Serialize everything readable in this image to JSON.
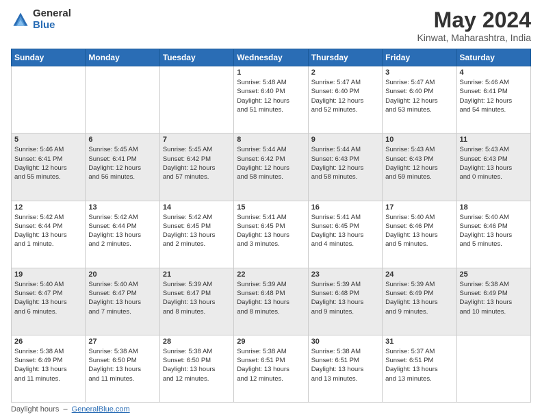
{
  "header": {
    "logo_general": "General",
    "logo_blue": "Blue",
    "month_title": "May 2024",
    "location": "Kinwat, Maharashtra, India"
  },
  "calendar": {
    "days_of_week": [
      "Sunday",
      "Monday",
      "Tuesday",
      "Wednesday",
      "Thursday",
      "Friday",
      "Saturday"
    ],
    "weeks": [
      {
        "id": 1,
        "cells": [
          {
            "day": "",
            "info": ""
          },
          {
            "day": "",
            "info": ""
          },
          {
            "day": "",
            "info": ""
          },
          {
            "day": "1",
            "info": "Sunrise: 5:48 AM\nSunset: 6:40 PM\nDaylight: 12 hours\nand 51 minutes."
          },
          {
            "day": "2",
            "info": "Sunrise: 5:47 AM\nSunset: 6:40 PM\nDaylight: 12 hours\nand 52 minutes."
          },
          {
            "day": "3",
            "info": "Sunrise: 5:47 AM\nSunset: 6:40 PM\nDaylight: 12 hours\nand 53 minutes."
          },
          {
            "day": "4",
            "info": "Sunrise: 5:46 AM\nSunset: 6:41 PM\nDaylight: 12 hours\nand 54 minutes."
          }
        ]
      },
      {
        "id": 2,
        "cells": [
          {
            "day": "5",
            "info": "Sunrise: 5:46 AM\nSunset: 6:41 PM\nDaylight: 12 hours\nand 55 minutes."
          },
          {
            "day": "6",
            "info": "Sunrise: 5:45 AM\nSunset: 6:41 PM\nDaylight: 12 hours\nand 56 minutes."
          },
          {
            "day": "7",
            "info": "Sunrise: 5:45 AM\nSunset: 6:42 PM\nDaylight: 12 hours\nand 57 minutes."
          },
          {
            "day": "8",
            "info": "Sunrise: 5:44 AM\nSunset: 6:42 PM\nDaylight: 12 hours\nand 58 minutes."
          },
          {
            "day": "9",
            "info": "Sunrise: 5:44 AM\nSunset: 6:43 PM\nDaylight: 12 hours\nand 58 minutes."
          },
          {
            "day": "10",
            "info": "Sunrise: 5:43 AM\nSunset: 6:43 PM\nDaylight: 12 hours\nand 59 minutes."
          },
          {
            "day": "11",
            "info": "Sunrise: 5:43 AM\nSunset: 6:43 PM\nDaylight: 13 hours\nand 0 minutes."
          }
        ]
      },
      {
        "id": 3,
        "cells": [
          {
            "day": "12",
            "info": "Sunrise: 5:42 AM\nSunset: 6:44 PM\nDaylight: 13 hours\nand 1 minute."
          },
          {
            "day": "13",
            "info": "Sunrise: 5:42 AM\nSunset: 6:44 PM\nDaylight: 13 hours\nand 2 minutes."
          },
          {
            "day": "14",
            "info": "Sunrise: 5:42 AM\nSunset: 6:45 PM\nDaylight: 13 hours\nand 2 minutes."
          },
          {
            "day": "15",
            "info": "Sunrise: 5:41 AM\nSunset: 6:45 PM\nDaylight: 13 hours\nand 3 minutes."
          },
          {
            "day": "16",
            "info": "Sunrise: 5:41 AM\nSunset: 6:45 PM\nDaylight: 13 hours\nand 4 minutes."
          },
          {
            "day": "17",
            "info": "Sunrise: 5:40 AM\nSunset: 6:46 PM\nDaylight: 13 hours\nand 5 minutes."
          },
          {
            "day": "18",
            "info": "Sunrise: 5:40 AM\nSunset: 6:46 PM\nDaylight: 13 hours\nand 5 minutes."
          }
        ]
      },
      {
        "id": 4,
        "cells": [
          {
            "day": "19",
            "info": "Sunrise: 5:40 AM\nSunset: 6:47 PM\nDaylight: 13 hours\nand 6 minutes."
          },
          {
            "day": "20",
            "info": "Sunrise: 5:40 AM\nSunset: 6:47 PM\nDaylight: 13 hours\nand 7 minutes."
          },
          {
            "day": "21",
            "info": "Sunrise: 5:39 AM\nSunset: 6:47 PM\nDaylight: 13 hours\nand 8 minutes."
          },
          {
            "day": "22",
            "info": "Sunrise: 5:39 AM\nSunset: 6:48 PM\nDaylight: 13 hours\nand 8 minutes."
          },
          {
            "day": "23",
            "info": "Sunrise: 5:39 AM\nSunset: 6:48 PM\nDaylight: 13 hours\nand 9 minutes."
          },
          {
            "day": "24",
            "info": "Sunrise: 5:39 AM\nSunset: 6:49 PM\nDaylight: 13 hours\nand 9 minutes."
          },
          {
            "day": "25",
            "info": "Sunrise: 5:38 AM\nSunset: 6:49 PM\nDaylight: 13 hours\nand 10 minutes."
          }
        ]
      },
      {
        "id": 5,
        "cells": [
          {
            "day": "26",
            "info": "Sunrise: 5:38 AM\nSunset: 6:49 PM\nDaylight: 13 hours\nand 11 minutes."
          },
          {
            "day": "27",
            "info": "Sunrise: 5:38 AM\nSunset: 6:50 PM\nDaylight: 13 hours\nand 11 minutes."
          },
          {
            "day": "28",
            "info": "Sunrise: 5:38 AM\nSunset: 6:50 PM\nDaylight: 13 hours\nand 12 minutes."
          },
          {
            "day": "29",
            "info": "Sunrise: 5:38 AM\nSunset: 6:51 PM\nDaylight: 13 hours\nand 12 minutes."
          },
          {
            "day": "30",
            "info": "Sunrise: 5:38 AM\nSunset: 6:51 PM\nDaylight: 13 hours\nand 13 minutes."
          },
          {
            "day": "31",
            "info": "Sunrise: 5:37 AM\nSunset: 6:51 PM\nDaylight: 13 hours\nand 13 minutes."
          },
          {
            "day": "",
            "info": ""
          }
        ]
      }
    ]
  },
  "footer": {
    "daylight_label": "Daylight hours",
    "site": "GeneralBlue.com"
  }
}
